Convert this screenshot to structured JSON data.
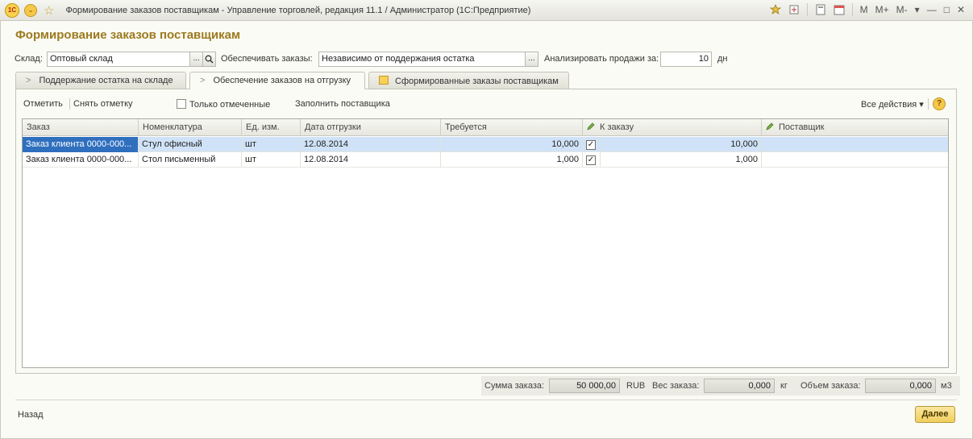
{
  "window": {
    "title": "Формирование заказов поставщикам - Управление торговлей, редакция 11.1 / Администратор  (1С:Предприятие)",
    "logo": "1С",
    "menu_icon": "⌄",
    "fav_icon": "☆",
    "right_labels": {
      "m": "M",
      "mplus": "M+",
      "mminus": "M-",
      "caret": "▾",
      "min": "—",
      "max": "□",
      "close": "✕"
    }
  },
  "page_title": "Формирование заказов поставщикам",
  "filters": {
    "warehouse_label": "Склад:",
    "warehouse_value": "Оптовый склад",
    "supply_label": "Обеспечивать заказы:",
    "supply_value": "Независимо от поддержания остатка",
    "analyze_label": "Анализировать продажи за:",
    "analyze_value": "10",
    "analyze_unit": "дн",
    "ellipsis": "...",
    "search_glyph": "🔍"
  },
  "tabs": [
    {
      "label": "Поддержание остатка на складе"
    },
    {
      "label": "Обеспечение заказов на отгрузку"
    },
    {
      "label": "Сформированные заказы поставщикам"
    }
  ],
  "commands": {
    "mark": "Отметить",
    "unmark": "Снять отметку",
    "only_marked": "Только отмеченные",
    "fill_supplier": "Заполнить поставщика",
    "all_actions": "Все действия",
    "help": "?"
  },
  "table": {
    "columns": [
      "Заказ",
      "Номенклатура",
      "Ед. изм.",
      "Дата отгрузки",
      "Требуется",
      "К заказу",
      "Поставщик"
    ],
    "rows": [
      {
        "order": "Заказ клиента 0000-000...",
        "item": "Стул офисный",
        "unit": "шт",
        "date": "12.08.2014",
        "required": "10,000",
        "checked": true,
        "to_order": "10,000",
        "supplier": ""
      },
      {
        "order": "Заказ клиента 0000-000...",
        "item": "Стол письменный",
        "unit": "шт",
        "date": "12.08.2014",
        "required": "1,000",
        "checked": true,
        "to_order": "1,000",
        "supplier": ""
      }
    ]
  },
  "summary": {
    "sum_label": "Сумма заказа:",
    "sum_value": "50 000,00",
    "currency": "RUB",
    "weight_label": "Вес заказа:",
    "weight_value": "0,000",
    "weight_unit": "кг",
    "volume_label": "Объем заказа:",
    "volume_value": "0,000",
    "volume_unit": "м3"
  },
  "footer": {
    "back": "Назад",
    "next": "Далее"
  },
  "colors": {
    "accent": "#9c7a1f",
    "selection": "#2f6fbe",
    "row_selected": "#cfe2f7"
  }
}
